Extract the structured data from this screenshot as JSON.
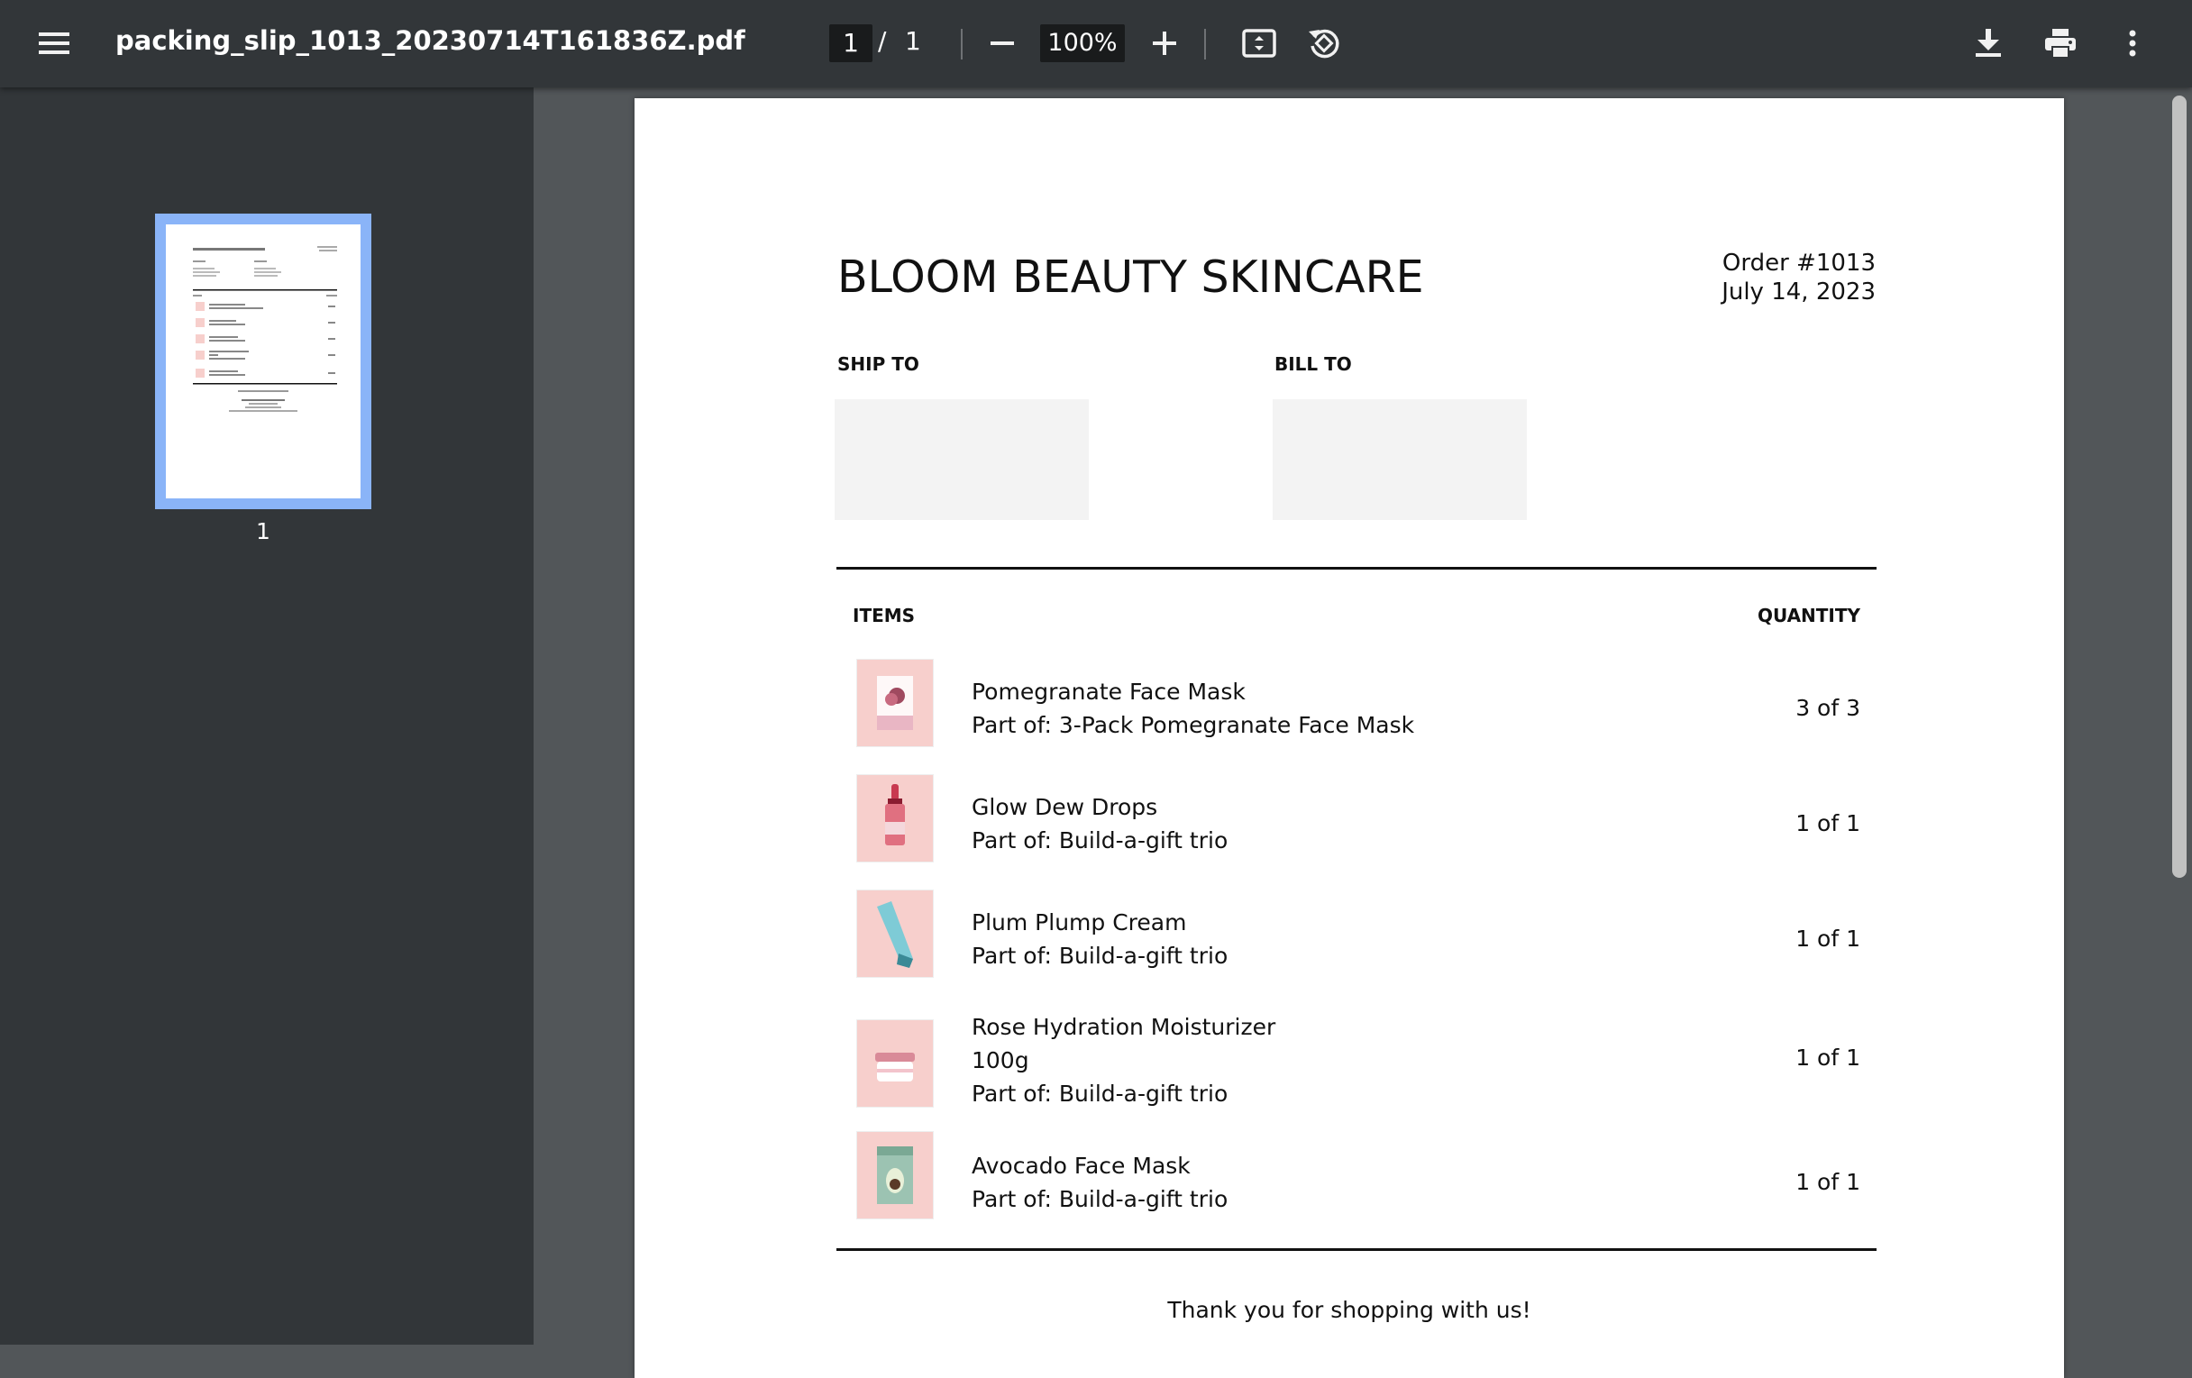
{
  "toolbar": {
    "file_name": "packing_slip_1013_20230714T161836Z.pdf",
    "current_page": "1",
    "page_separator": "/",
    "total_pages": "1",
    "zoom": "100%"
  },
  "sidebar": {
    "thumbnail_label": "1"
  },
  "document": {
    "shop_name": "BLOOM BEAUTY SKINCARE",
    "order_number": "Order #1013",
    "order_date": "July 14, 2023",
    "ship_to_label": "SHIP TO",
    "bill_to_label": "BILL TO",
    "items_header": "ITEMS",
    "quantity_header": "QUANTITY",
    "items": [
      {
        "name": "Pomegranate Face Mask",
        "variant": "",
        "part_of": "Part of: 3-Pack Pomegranate Face Mask",
        "qty": "3 of 3"
      },
      {
        "name": "Glow Dew Drops",
        "variant": "",
        "part_of": "Part of: Build-a-gift trio",
        "qty": "1 of 1"
      },
      {
        "name": "Plum Plump Cream",
        "variant": "",
        "part_of": "Part of: Build-a-gift trio",
        "qty": "1 of 1"
      },
      {
        "name": "Rose Hydration Moisturizer",
        "variant": "100g",
        "part_of": "Part of: Build-a-gift trio",
        "qty": "1 of 1"
      },
      {
        "name": "Avocado Face Mask",
        "variant": "",
        "part_of": "Part of: Build-a-gift trio",
        "qty": "1 of 1"
      }
    ],
    "thanks": "Thank you for shopping with us!"
  },
  "colors": {
    "toolbar_bg": "#323639",
    "viewer_bg": "#525659",
    "thumbnail_highlight": "#8ab4f8",
    "product_bg": "#f7cfcc"
  },
  "icons": {
    "menu": "menu-icon",
    "zoom_out": "minus-icon",
    "zoom_in": "plus-icon",
    "fit": "fit-page-icon",
    "rotate": "rotate-icon",
    "download": "download-icon",
    "print": "print-icon",
    "more": "more-vert-icon"
  }
}
